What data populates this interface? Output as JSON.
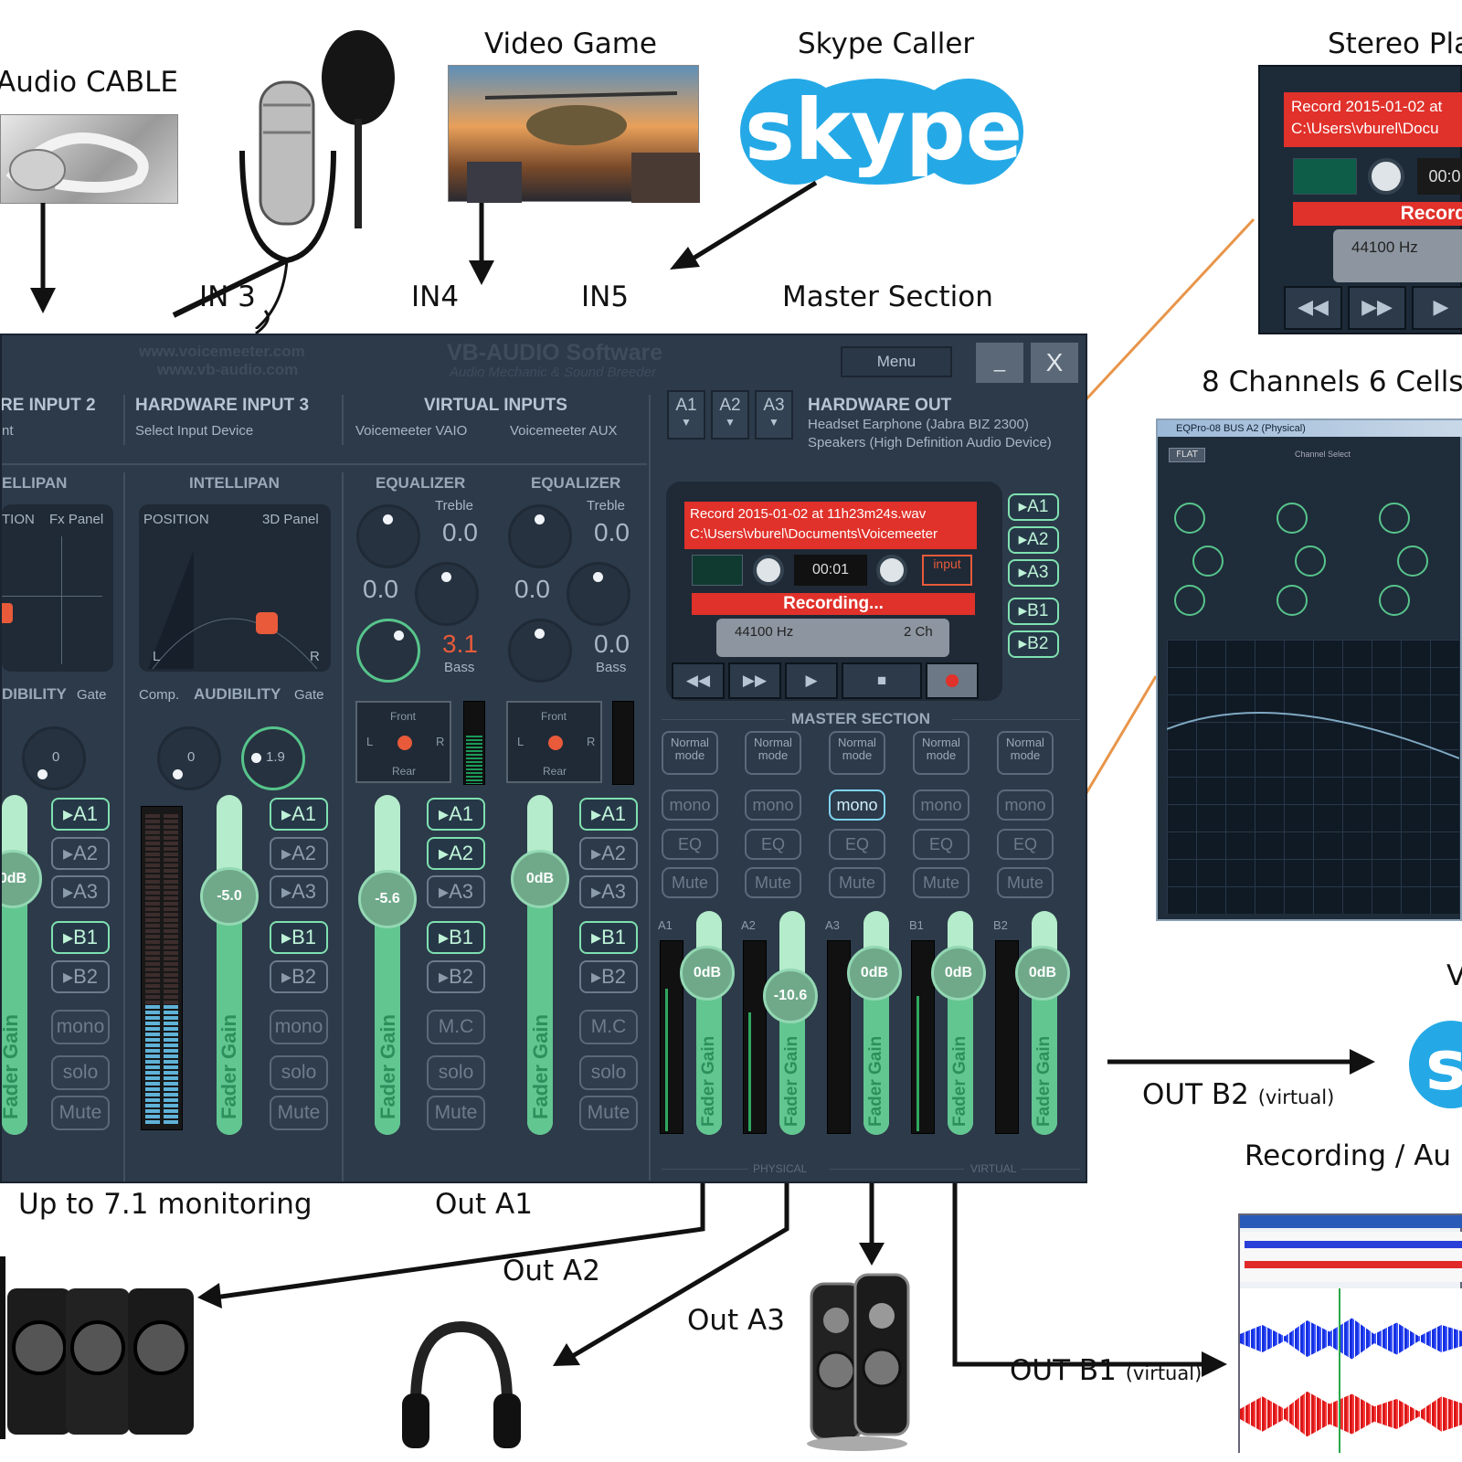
{
  "sources": {
    "audio_cable": "Audio CABLE",
    "video_game": "Video Game",
    "skype_caller": "Skype Caller",
    "stereo_player": "Stereo Pla",
    "skype_logo": "skype",
    "in3": "IN 3",
    "in4": "IN4",
    "in5": "IN5",
    "master_section": "Master Section",
    "eight_channels": "8 Channels 6 Cells"
  },
  "outputs": {
    "monitoring": "Up to 7.1 monitoring",
    "out_a1": "Out A1",
    "out_a2": "Out A2",
    "out_a3": "Out A3",
    "out_b1": "OUT B1",
    "out_b1_note": "(virtual)",
    "out_b2": "OUT B2",
    "out_b2_note": "(virtual)",
    "recording": "Recording / Au",
    "skype_v": "V"
  },
  "mixer": {
    "brand_url1": "www.voicemeeter.com",
    "brand_url2": "www.vb-audio.com",
    "brand_name": "VB-AUDIO Software",
    "brand_tag": "Audio Mechanic & Sound Breeder",
    "menu": "Menu",
    "minimize": "_",
    "close": "X",
    "hw_input_2": "RE INPUT  2",
    "hw_input_2_sub": "nt",
    "hw_input_3": "HARDWARE INPUT  3",
    "hw_input_3_sub": "Select Input Device",
    "virtual_inputs": "VIRTUAL INPUTS",
    "vaio": "Voicemeeter VAIO",
    "aux": "Voicemeeter AUX",
    "a1": "A1",
    "a2": "A2",
    "a3": "A3",
    "hardware_out": "HARDWARE OUT",
    "hw_out_1": "Headset Earphone (Jabra BIZ 2300)",
    "hw_out_2": "Speakers (High Definition Audio Device)",
    "intellipan_2": "ELLIPAN",
    "intellipan_3": "INTELLIPAN",
    "position_2": "TION",
    "fx_panel": "Fx Panel",
    "position_3": "POSITION",
    "panel_3d": "3D Panel",
    "pan_l": "L",
    "pan_r": "R",
    "equalizer": "EQUALIZER",
    "treble": "Treble",
    "bass": "Bass",
    "eq1_treble": "0.0",
    "eq1_mid": "0.0",
    "eq1_bass": "3.1",
    "eq2_treble": "0.0",
    "eq2_mid": "0.0",
    "eq2_bass": "0.0",
    "front": "Front",
    "rear": "Rear",
    "audibility_2": "DIBILITY",
    "audibility_3": "AUDIBILITY",
    "gate": "Gate",
    "comp": "Comp.",
    "knob_a": "0",
    "knob_b": "0",
    "knob_c": "1.9",
    "bus_a1": "A1",
    "bus_a2": "A2",
    "bus_a3": "A3",
    "bus_b1": "B1",
    "bus_b2": "B2",
    "mono": "mono",
    "solo": "solo",
    "mute": "Mute",
    "mc": "M.C",
    "fader_gain": "Fader Gain",
    "strip_gains": [
      "0dB",
      "-5.0",
      "-5.6",
      "0dB"
    ],
    "recorder": {
      "line1": "Record 2015-01-02 at 11h23m24s.wav",
      "line2": "C:\\Users\\vburel\\Documents\\Voicemeeter",
      "time": "00:01",
      "input": "input",
      "status": "Recording...",
      "rate": "44100 Hz",
      "channels": "2 Ch"
    },
    "master_section": "MASTER SECTION",
    "normal_mode": "Normal mode",
    "eq": "EQ",
    "master_labels": [
      "A1",
      "A2",
      "A3",
      "B1",
      "B2"
    ],
    "master_gains": [
      "0dB",
      "-10.6",
      "0dB",
      "0dB",
      "0dB"
    ],
    "physical": "PHYSICAL",
    "virtual": "VIRTUAL"
  },
  "stereo_player": {
    "line1": "Record 2015-01-02 at",
    "line2": "C:\\Users\\vburel\\Docu",
    "time": "00:0",
    "status": "Record",
    "rate": "44100 Hz"
  },
  "eq_window": {
    "title": "EQPro-08 BUS A2 (Physical)",
    "flat": "FLAT",
    "channel_select": "Channel Select"
  },
  "colors": {
    "mixer_bg": "#2c3a4a",
    "accent_green": "#62c690",
    "record_red": "#e0312a",
    "orange_line": "#e8954a"
  }
}
